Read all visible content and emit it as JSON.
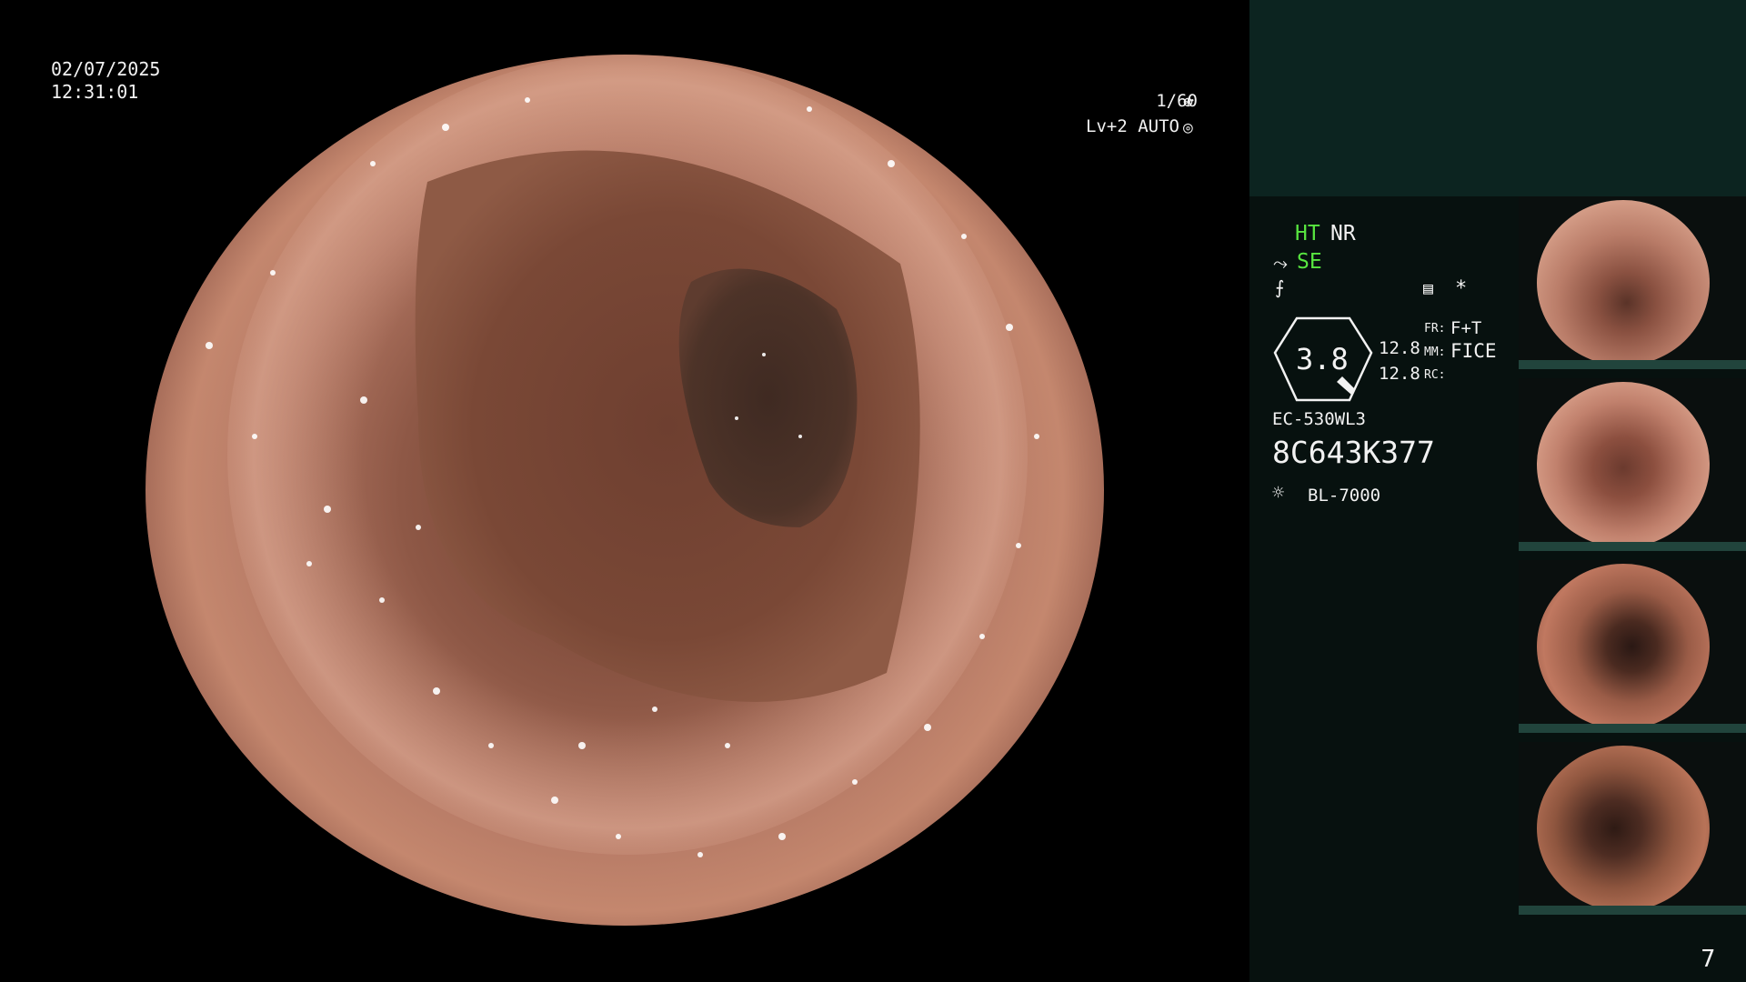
{
  "overlay": {
    "date": "02/07/2025",
    "time": "12:31:01",
    "shutter": "1/60",
    "level": "Lv+2",
    "mode": "AUTO"
  },
  "icons": {
    "shutter": "aperture-icon",
    "auto": "iris-icon",
    "structure": "structure-enhance-icon",
    "color": "color-enhance-icon",
    "image_settings": "image-settings-icon",
    "asterisk": "asterisk-icon",
    "lamp": "light-source-icon"
  },
  "settings": {
    "ht": "HT",
    "nr": "NR",
    "se": "SE",
    "asterisk": "*",
    "zoom": "3.8",
    "val1": "12.8",
    "val2": "12.8",
    "fr_label": "FR:",
    "fr_value": "F+T",
    "mm_label": "MM:",
    "mm_value": "FICE",
    "rc_label": "RC:",
    "scope_model": "EC-530WL3",
    "serial": "8C643K377",
    "light_source": "BL-7000"
  },
  "page_number": "7",
  "colors": {
    "accent_green": "#58e640",
    "panel_bg": "#07110f",
    "panel_top": "#0c2420",
    "thumb_bar": "#21443c"
  }
}
